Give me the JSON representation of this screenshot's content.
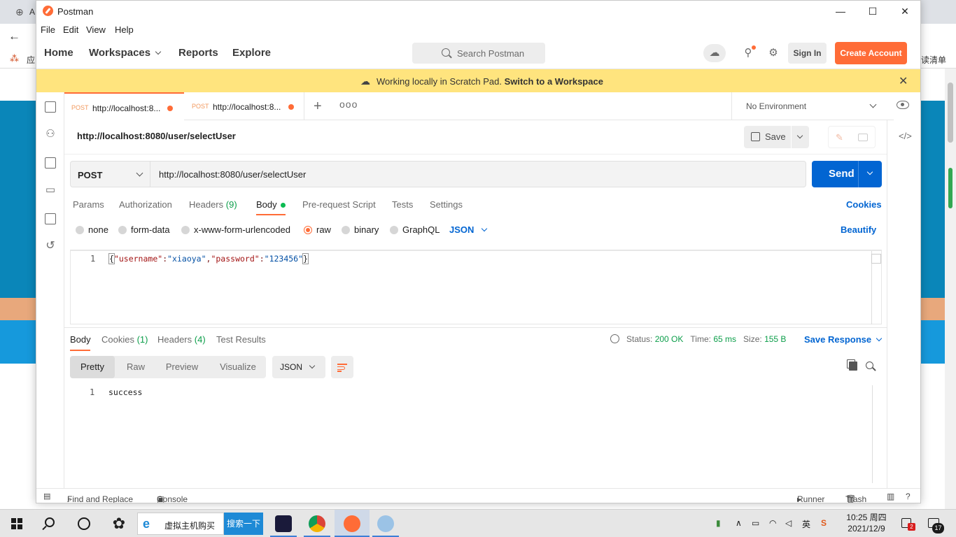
{
  "window": {
    "title": "Postman",
    "controls": {
      "minimize": "—",
      "maximize": "☐",
      "close": "✕"
    }
  },
  "menu": [
    "File",
    "Edit",
    "View",
    "Help"
  ],
  "header": {
    "nav": [
      "Home",
      "Workspaces",
      "Reports",
      "Explore"
    ],
    "search_placeholder": "Search Postman",
    "sign_in": "Sign In",
    "create_account": "Create Account"
  },
  "banner": {
    "message": "Working locally in Scratch Pad.",
    "link": "Switch to a Workspace"
  },
  "tabs": [
    {
      "method": "POST",
      "url": "http://localhost:8..."
    },
    {
      "method": "POST",
      "url": "http://localhost:8..."
    }
  ],
  "environment": "No Environment",
  "request": {
    "name": "http://localhost:8080/user/selectUser",
    "method": "POST",
    "url": "http://localhost:8080/user/selectUser",
    "save_label": "Save",
    "send_label": "Send"
  },
  "request_tabs": {
    "params": "Params",
    "authorization": "Authorization",
    "headers": "Headers",
    "headers_count": "(9)",
    "body": "Body",
    "prerequest": "Pre-request Script",
    "tests": "Tests",
    "settings": "Settings",
    "cookies": "Cookies"
  },
  "body_types": {
    "none": "none",
    "form_data": "form-data",
    "urlencoded": "x-www-form-urlencoded",
    "raw": "raw",
    "binary": "binary",
    "graphql": "GraphQL",
    "format": "JSON",
    "beautify": "Beautify"
  },
  "request_body": {
    "line": "1",
    "open": "{",
    "key1": "\"username\"",
    "colon1": ":",
    "val1": "\"xiaoya\"",
    "comma": ",",
    "key2": "\"password\"",
    "colon2": ":",
    "val2": "\"123456\"",
    "close": "}"
  },
  "response_tabs": {
    "body": "Body",
    "cookies": "Cookies",
    "cookies_count": "(1)",
    "headers": "Headers",
    "headers_count": "(4)",
    "test_results": "Test Results"
  },
  "response_status": {
    "status_label": "Status:",
    "status": "200 OK",
    "time_label": "Time:",
    "time": "65 ms",
    "size_label": "Size:",
    "size": "155 B",
    "save_response": "Save Response"
  },
  "response_view": {
    "pretty": "Pretty",
    "raw": "Raw",
    "preview": "Preview",
    "visualize": "Visualize",
    "format": "JSON"
  },
  "response_body": {
    "line": "1",
    "text": "success"
  },
  "footer": {
    "find_replace": "Find and Replace",
    "console": "Console",
    "runner": "Runner",
    "trash": "Trash"
  },
  "taskbar": {
    "ie_text": "虚拟主机购买",
    "search_button": "搜索一下",
    "ime": "英",
    "time": "10:25 周四",
    "date": "2021/12/9",
    "badge_count": "2",
    "notif_count": "17"
  },
  "background_browser": {
    "tab_fragment": "A",
    "bookmark_fragment": "应",
    "bookmark_right": "读清单"
  },
  "colors": {
    "brand_orange": "#ff6c37",
    "send_blue": "#0265d2",
    "banner_yellow": "#ffe47e",
    "success_green": "#0c9e4a"
  }
}
